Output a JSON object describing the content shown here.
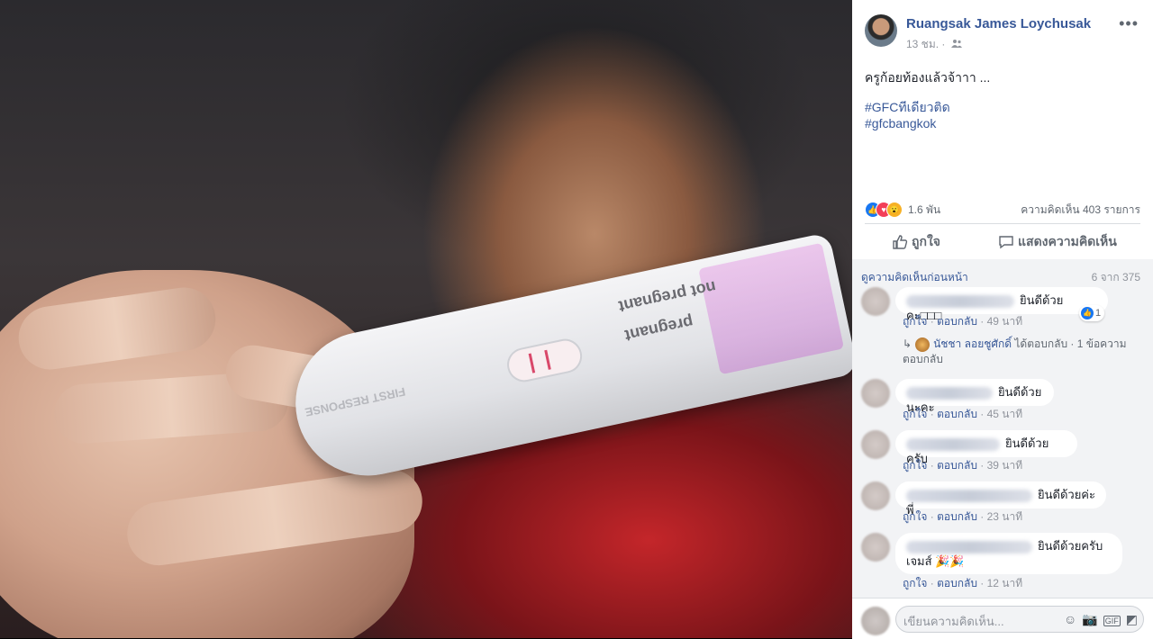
{
  "post": {
    "author": "Ruangsak James Loychusak",
    "time": "13 ชม. ·",
    "text": "ครูก้อยท้องแล้วจ้าาา ...",
    "hashtags": [
      "#GFCทีเดียวติด",
      "#gfcbangkok"
    ],
    "reactions_count": "1.6 พัน",
    "comments_count": "ความคิดเห็น 403 รายการ"
  },
  "photo": {
    "test_labels": [
      "not pregnant",
      "pregnant"
    ],
    "brand_text": "FIRST RESPONSE"
  },
  "actions": {
    "like": "ถูกใจ",
    "comment": "แสดงความคิดเห็น"
  },
  "comments": {
    "view_previous": "ดูความคิดเห็นก่อนหน้า",
    "count": "6 จาก 375",
    "like_label": "ถูกใจ",
    "reply_label": "ตอบกลับ",
    "items": [
      {
        "text": "ยินดีด้วยคะ□□□",
        "time": "49 นาที",
        "likes": "1"
      },
      {
        "text": "ยินดีด้วยนะคะ",
        "time": "45 นาที"
      },
      {
        "text": "ยินดีด้วยครับ",
        "time": "39 นาที"
      },
      {
        "text": "ยินดีด้วยค่ะพี่",
        "time": "23 นาที"
      },
      {
        "text": "ยินดีด้วยครับ",
        "text2": "เจมส์ 🎉🎉",
        "time": "12 นาที"
      }
    ],
    "reply": {
      "name": "นัชชา ลอยชูศักดิ์",
      "text": "ได้ตอบกลับ · 1 ข้อความตอบกลับ"
    }
  },
  "compose": {
    "placeholder": "เขียนความคิดเห็น..."
  },
  "colors": {
    "link": "#385898",
    "like_blue": "#1877f2",
    "love_red": "#f33e58",
    "wow_yellow": "#f7b125"
  }
}
